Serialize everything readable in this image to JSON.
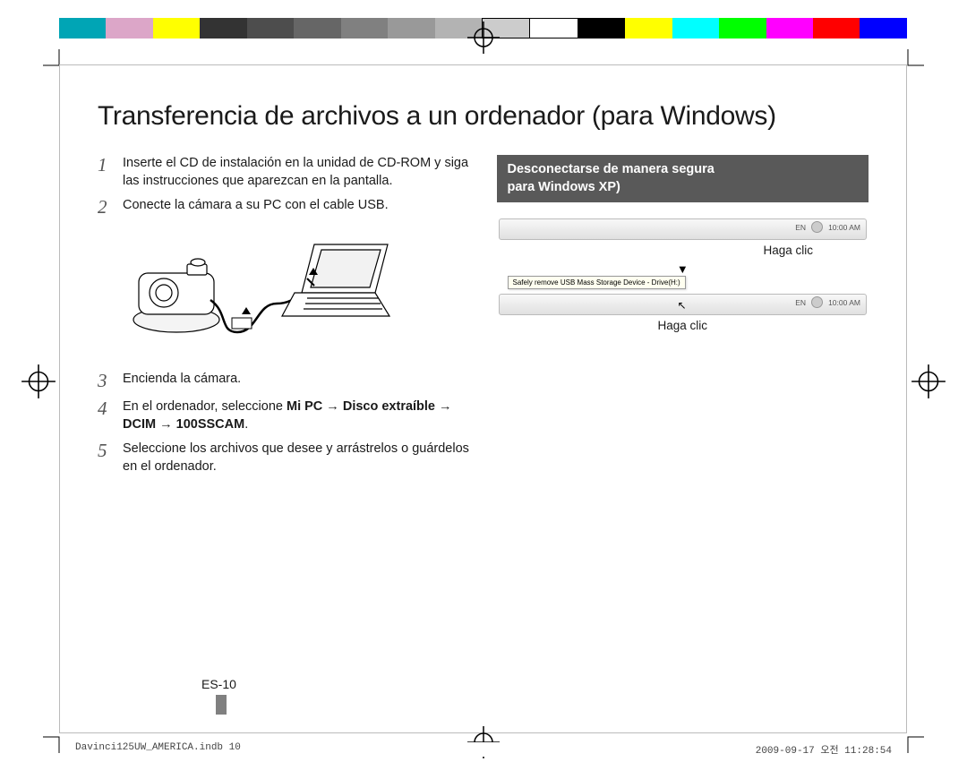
{
  "colorBar": [
    "#00a5b5",
    "#dca6c8",
    "#ffff00",
    "#333333",
    "#4d4d4d",
    "#666666",
    "#808080",
    "#999999",
    "#b3b3b3",
    "#cccccc",
    "#ffffff",
    "#000000",
    "#ffff00",
    "#00ffff",
    "#00ff00",
    "#ff00ff",
    "#ff0000",
    "#0000ff"
  ],
  "title": "Transferencia de archivos a un ordenador (para Windows)",
  "steps": {
    "s1": "Inserte el CD de instalación en la unidad de CD-ROM y siga las instrucciones que aparezcan en la pantalla.",
    "s2": "Conecte la cámara a su PC con el cable USB.",
    "s3": "Encienda la cámara.",
    "s4_pre": "En el ordenador, seleccione ",
    "s4_b1": "Mi PC",
    "s4_arr": " → ",
    "s4_b2": "Disco extraíble",
    "s4_b3": "DCIM",
    "s4_b4": "100SSCAM",
    "s5": "Seleccione los archivos que desee y arrástrelos o guárdelos en el ordenador."
  },
  "side": {
    "heading_l1": "Desconectarse de manera segura",
    "heading_l2": "para Windows XP)",
    "heading_full": "Desconectarse de manera segura para Windows XP)",
    "click": "Haga clic",
    "arrow": "▼",
    "balloon": "Safely remove USB Mass Storage Device - Drive(H:)",
    "lang": "EN",
    "time": "10:00 AM"
  },
  "pageNum": "ES-10",
  "footer": {
    "left": "Davinci125UW_AMERICA.indb   10",
    "right": "2009-09-17   오전 11:28:54"
  }
}
